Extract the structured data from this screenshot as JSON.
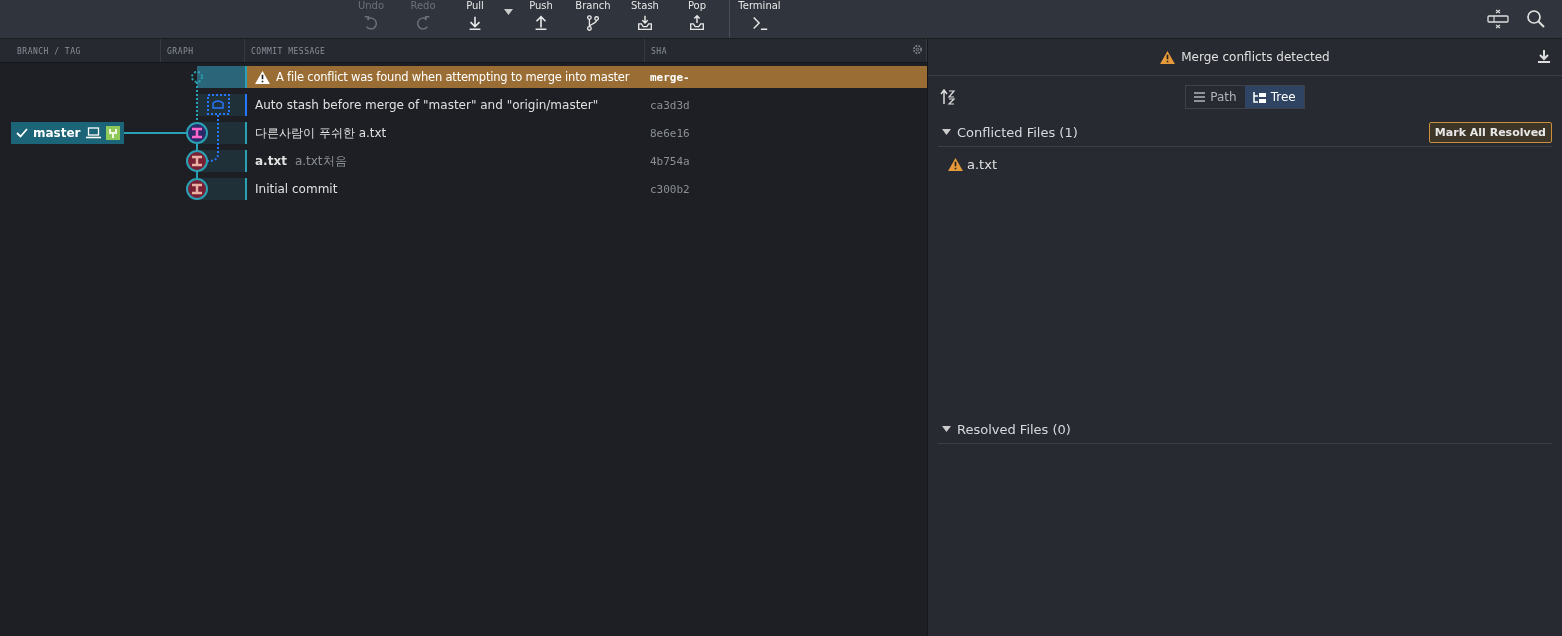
{
  "toolbar": {
    "buttons": [
      {
        "label": "Undo",
        "kind": "undo",
        "disabled": true
      },
      {
        "label": "Redo",
        "kind": "redo",
        "disabled": true
      },
      {
        "label": "Pull",
        "kind": "pull",
        "disabled": false
      },
      {
        "label": "Push",
        "kind": "push",
        "disabled": false
      },
      {
        "label": "Branch",
        "kind": "branch",
        "disabled": false
      },
      {
        "label": "Stash",
        "kind": "stash",
        "disabled": false
      },
      {
        "label": "Pop",
        "kind": "pop",
        "disabled": false
      },
      {
        "label": "Terminal",
        "kind": "terminal",
        "disabled": false
      }
    ]
  },
  "graph": {
    "columns": [
      "BRANCH / TAG",
      "GRAPH",
      "COMMIT MESSAGE",
      "SHA"
    ],
    "branch": {
      "name": "master",
      "checked": true
    },
    "rows": [
      {
        "kind": "conflict",
        "message": "A file conflict was found when attempting to merge into master",
        "sha": "merge-"
      },
      {
        "kind": "stash",
        "message": "Auto stash before merge of \"master\" and \"origin/master\"",
        "sha": "ca3d3d"
      },
      {
        "kind": "commit",
        "message": "다른사람이 푸쉬한 a.txt",
        "sha": "8e6e16"
      },
      {
        "kind": "commit",
        "message": "a.txt",
        "detail": "a.txt처음",
        "sha": "4b754a"
      },
      {
        "kind": "commit",
        "message": "Initial commit",
        "sha": "c300b2"
      }
    ]
  },
  "panel": {
    "title": "Merge conflicts detected",
    "views": [
      {
        "label": "Path",
        "selected": false
      },
      {
        "label": "Tree",
        "selected": true
      }
    ],
    "sections": [
      {
        "title": "Conflicted Files (1)",
        "expanded": true,
        "action": "Mark All Resolved",
        "files": [
          "a.txt"
        ]
      },
      {
        "title": "Resolved Files (0)",
        "expanded": true
      }
    ]
  }
}
